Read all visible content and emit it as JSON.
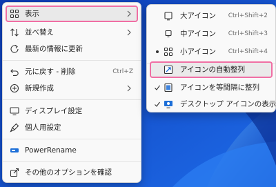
{
  "main_menu": {
    "items": [
      {
        "label": "表示",
        "icon": "grid-view-icon"
      },
      {
        "label": "並べ替え",
        "icon": "sort-icon"
      },
      {
        "label": "最新の情報に更新",
        "icon": "refresh-icon"
      },
      {
        "label": "元に戻す - 削除",
        "shortcut": "Ctrl+Z",
        "icon": "undo-icon"
      },
      {
        "label": "新規作成",
        "icon": "new-plus-icon"
      },
      {
        "label": "ディスプレイ設定",
        "icon": "display-icon"
      },
      {
        "label": "個人用設定",
        "icon": "brush-icon"
      },
      {
        "label": "PowerRename",
        "icon": "powerrename-icon"
      },
      {
        "label": "その他のオプションを確認",
        "icon": "share-icon"
      }
    ]
  },
  "view_submenu": {
    "items": [
      {
        "label": "大アイコン",
        "shortcut": "Ctrl+Shift+2",
        "icon": "large-icon-view-icon"
      },
      {
        "label": "中アイコン",
        "shortcut": "Ctrl+Shift+3",
        "icon": "medium-icon-view-icon"
      },
      {
        "label": "小アイコン",
        "shortcut": "Ctrl+Shift+4",
        "icon": "small-icon-view-icon",
        "selected": true
      },
      {
        "label": "アイコンの自動整列",
        "icon": "auto-arrange-icon"
      },
      {
        "label": "アイコンを等間隔に整列",
        "icon": "align-grid-icon",
        "checked": true
      },
      {
        "label": "デスクトップ アイコンの表示",
        "icon": "desktop-icons-icon",
        "checked": true
      }
    ]
  },
  "colors": {
    "highlight_border": "#f06fa4",
    "wallpaper": "#1e5bd6"
  }
}
